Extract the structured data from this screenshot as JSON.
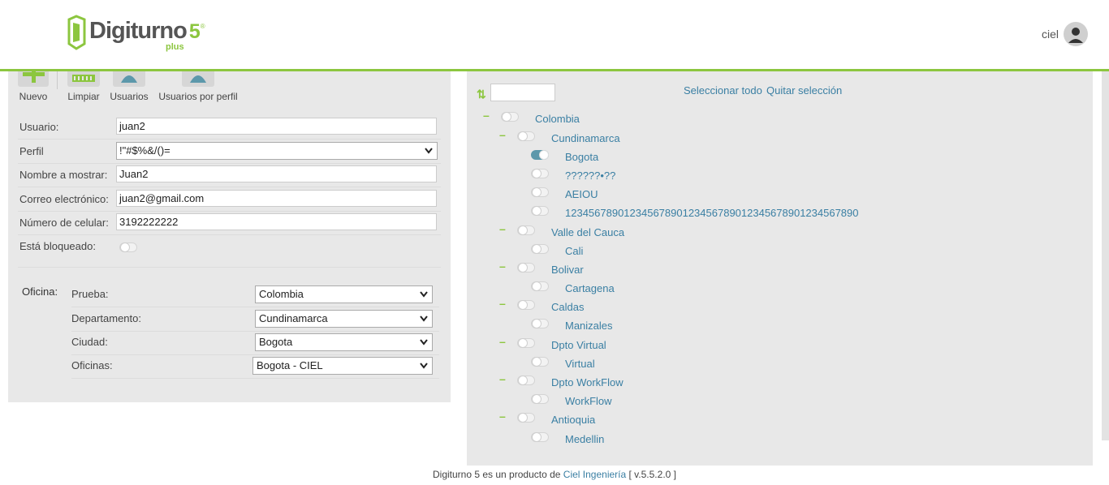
{
  "header": {
    "logo": {
      "name": "Digiturno",
      "version": "5",
      "reg": "®",
      "edition": "plus"
    },
    "user": {
      "name": "ciel",
      "avatar_icon": "user-avatar-icon"
    }
  },
  "toolbar": {
    "buttons": [
      {
        "label": "Nuevo",
        "icon": "plus-icon"
      },
      {
        "label": "Limpiar",
        "icon": "broom-icon"
      },
      {
        "label": "Usuarios",
        "icon": "users-icon"
      },
      {
        "label": "Usuarios por perfil",
        "icon": "user-profile-icon"
      }
    ]
  },
  "form": {
    "usuario": {
      "label": "Usuario:",
      "value": "juan2"
    },
    "perfil": {
      "label": "Perfil",
      "value": "!\"#$%&/()="
    },
    "nombre": {
      "label": "Nombre a mostrar:",
      "value": "Juan2"
    },
    "correo": {
      "label": "Correo electrónico:",
      "value": "juan2@gmail.com"
    },
    "celular": {
      "label": "Número de celular:",
      "value": "3192222222"
    },
    "bloqueado": {
      "label": "Está bloqueado:",
      "value": false
    }
  },
  "oficina": {
    "label": "Oficina:",
    "prueba": {
      "label": "Prueba:",
      "value": "Colombia"
    },
    "departamento": {
      "label": "Departamento:",
      "value": "Cundinamarca"
    },
    "ciudad": {
      "label": "Ciudad:",
      "value": "Bogota"
    },
    "oficinas": {
      "label": "Oficinas:",
      "value": "Bogota - CIEL"
    }
  },
  "tree": {
    "select_all": "Seleccionar todo",
    "clear_selection": "Quitar selección",
    "sort_icon": "sort-icon",
    "nodes": [
      {
        "label": "Colombia",
        "level": 0,
        "on": false
      },
      {
        "label": "Cundinamarca",
        "level": 1,
        "on": false
      },
      {
        "label": "Bogota",
        "level": 2,
        "on": true
      },
      {
        "label": "??????•??",
        "level": 2,
        "on": false
      },
      {
        "label": "AEIOU",
        "level": 2,
        "on": false
      },
      {
        "label": "12345678901234567890123456789012345678901234567890",
        "level": 2,
        "on": false
      },
      {
        "label": "Valle del Cauca",
        "level": 1,
        "on": false
      },
      {
        "label": "Cali",
        "level": 2,
        "on": false
      },
      {
        "label": "Bolivar",
        "level": 1,
        "on": false
      },
      {
        "label": "Cartagena",
        "level": 2,
        "on": false
      },
      {
        "label": "Caldas",
        "level": 1,
        "on": false
      },
      {
        "label": "Manizales",
        "level": 2,
        "on": false
      },
      {
        "label": "Dpto Virtual",
        "level": 1,
        "on": false
      },
      {
        "label": "Virtual",
        "level": 2,
        "on": false
      },
      {
        "label": "Dpto WorkFlow",
        "level": 1,
        "on": false
      },
      {
        "label": "WorkFlow",
        "level": 2,
        "on": false
      },
      {
        "label": "Antioquia",
        "level": 1,
        "on": false
      },
      {
        "label": "Medellin",
        "level": 2,
        "on": false
      }
    ]
  },
  "footer": {
    "text": "Digiturno 5 es un producto de",
    "link": "Ciel Ingeniería",
    "version": "[ v.5.5.2.0 ]"
  },
  "colors": {
    "accent": "#8cc63f",
    "link": "#3a7fa3",
    "toggle_on": "#5c98ab",
    "panel": "#e8e8e8"
  }
}
